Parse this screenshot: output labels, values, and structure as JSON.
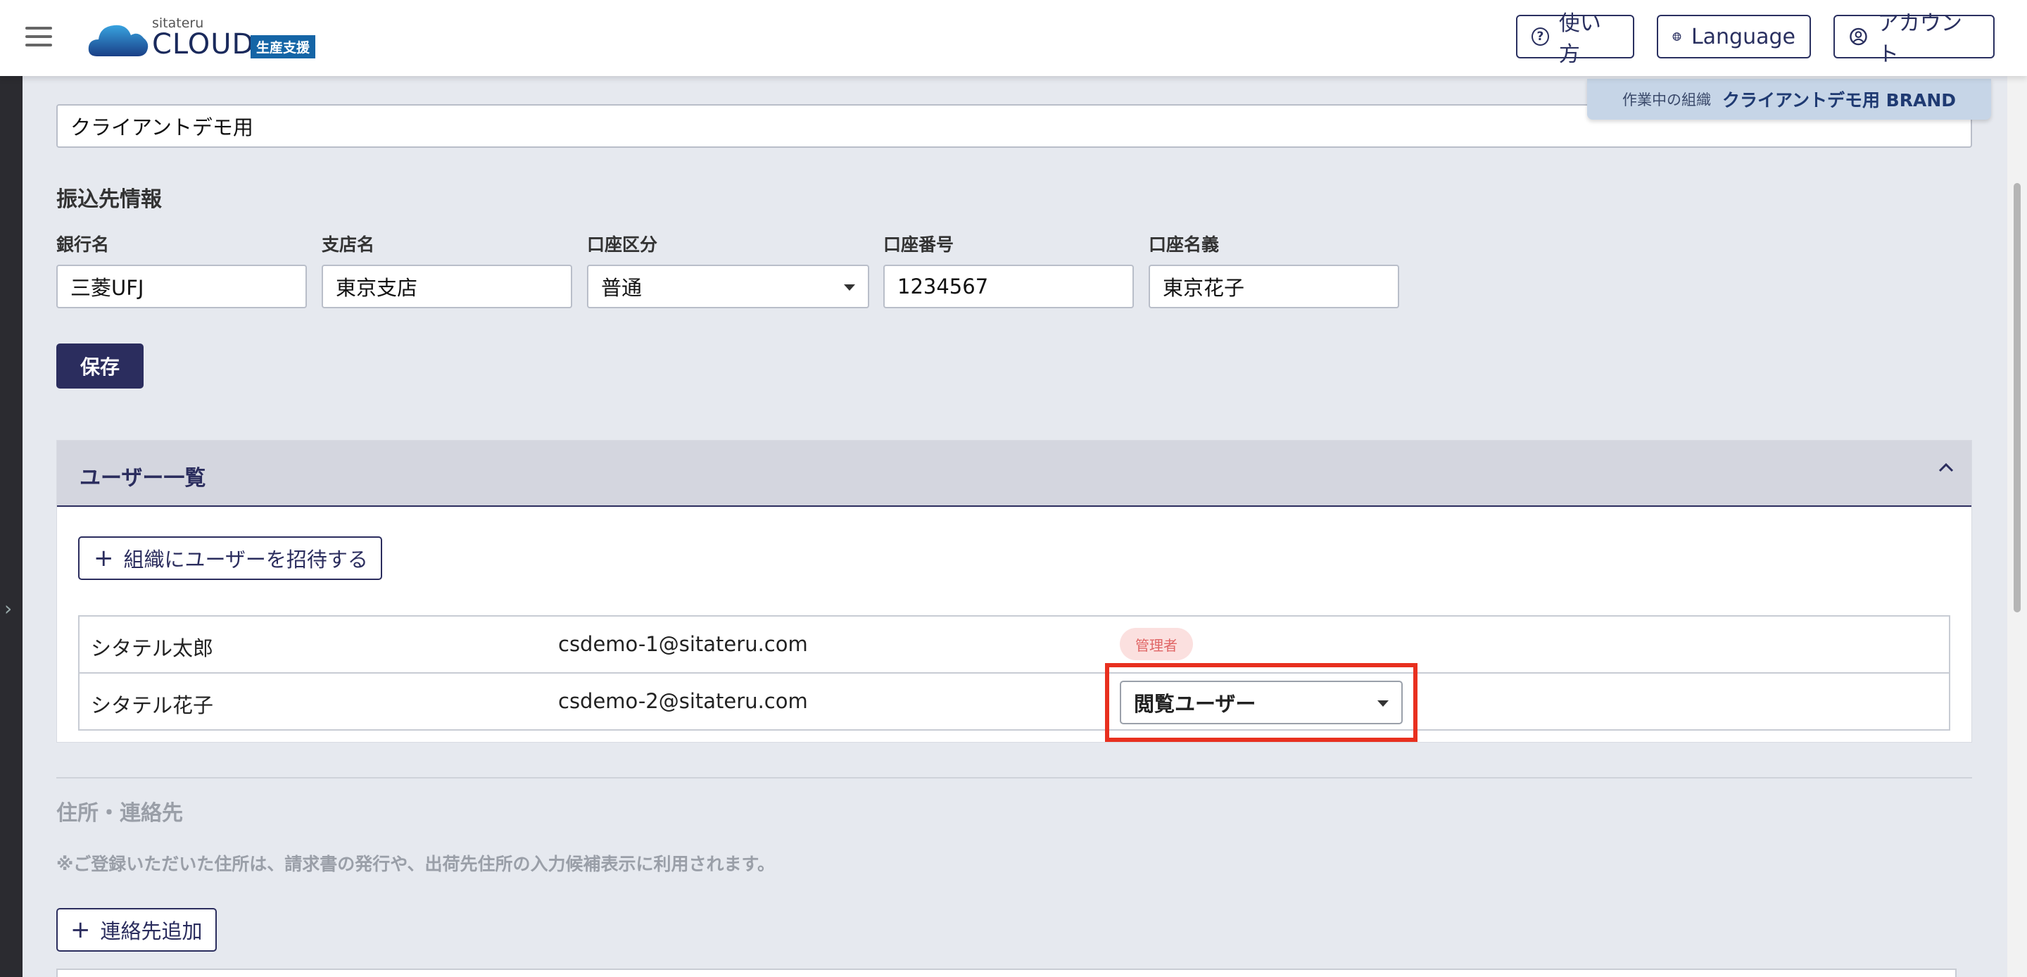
{
  "header": {
    "logo_small": "sitateru",
    "logo_main": "CLOUD",
    "logo_badge": "生産支援",
    "help_label": "使い方",
    "language_label": "Language",
    "account_label": "アカウント"
  },
  "org_banner": {
    "label": "作業中の組織",
    "name": "クライアントデモ用 BRAND"
  },
  "organization": {
    "name_value": "クライアントデモ用"
  },
  "bank": {
    "section_title": "振込先情報",
    "bank_name_label": "銀行名",
    "bank_name_value": "三菱UFJ",
    "branch_label": "支店名",
    "branch_value": "東京支店",
    "account_type_label": "口座区分",
    "account_type_value": "普通",
    "account_number_label": "口座番号",
    "account_number_value": "1234567",
    "account_holder_label": "口座名義",
    "account_holder_value": "東京花子",
    "save_label": "保存"
  },
  "users": {
    "title": "ユーザー一覧",
    "invite_label": "組織にユーザーを招待する",
    "rows": [
      {
        "name": "シタテル太郎",
        "email": "csdemo-1@sitateru.com",
        "role": "管理者"
      },
      {
        "name": "シタテル花子",
        "email": "csdemo-2@sitateru.com",
        "role": "閲覧ユーザー"
      }
    ]
  },
  "address": {
    "title": "住所・連絡先",
    "note": "※ご登録いただいた住所は、請求書の発行や、出荷先住所の入力候補表示に利用されます。",
    "add_contact_label": "連絡先追加"
  },
  "colors": {
    "primary": "#2b2d5e",
    "highlight": "#e8301f",
    "admin_badge_bg": "#fbe0df",
    "admin_badge_text": "#e06666"
  }
}
